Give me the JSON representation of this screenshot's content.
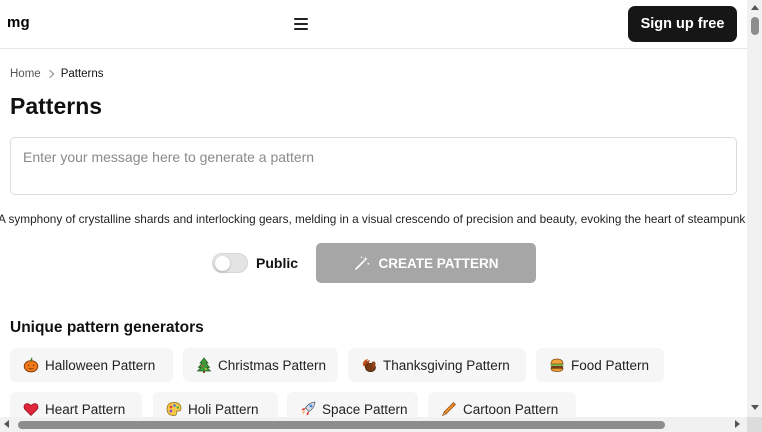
{
  "header": {
    "logo": "mg",
    "menu_icon": "hamburger-icon",
    "signup_label": "Sign up free"
  },
  "breadcrumb": {
    "home": "Home",
    "separator_icon": "chevron-right-icon",
    "current": "Patterns"
  },
  "page_title": "Patterns",
  "prompt": {
    "placeholder": "Enter your message here to generate a pattern",
    "value": ""
  },
  "sample_prompt": "A symphony of crystalline shards and interlocking gears, melding in a visual crescendo of precision and beauty, evoking the heart of steampunk artistry.",
  "controls": {
    "public_label": "Public",
    "public_on": false,
    "create_label": "CREATE PATTERN",
    "create_icon": "magic-wand-icon"
  },
  "generators": {
    "title": "Unique pattern generators",
    "items": [
      {
        "label": "Halloween Pattern",
        "icon": "pumpkin-icon"
      },
      {
        "label": "Christmas Pattern",
        "icon": "christmas-tree-icon"
      },
      {
        "label": "Thanksgiving Pattern",
        "icon": "turkey-icon"
      },
      {
        "label": "Food Pattern",
        "icon": "burger-icon"
      },
      {
        "label": "Heart Pattern",
        "icon": "heart-icon"
      },
      {
        "label": "Holi Pattern",
        "icon": "paint-palette-icon"
      },
      {
        "label": "Space Pattern",
        "icon": "rocket-icon"
      },
      {
        "label": "Cartoon Pattern",
        "icon": "crayon-icon"
      }
    ]
  },
  "colors": {
    "signup_bg": "#161616",
    "create_bg": "#a6a6a6",
    "chip_bg": "#f6f6f6"
  }
}
